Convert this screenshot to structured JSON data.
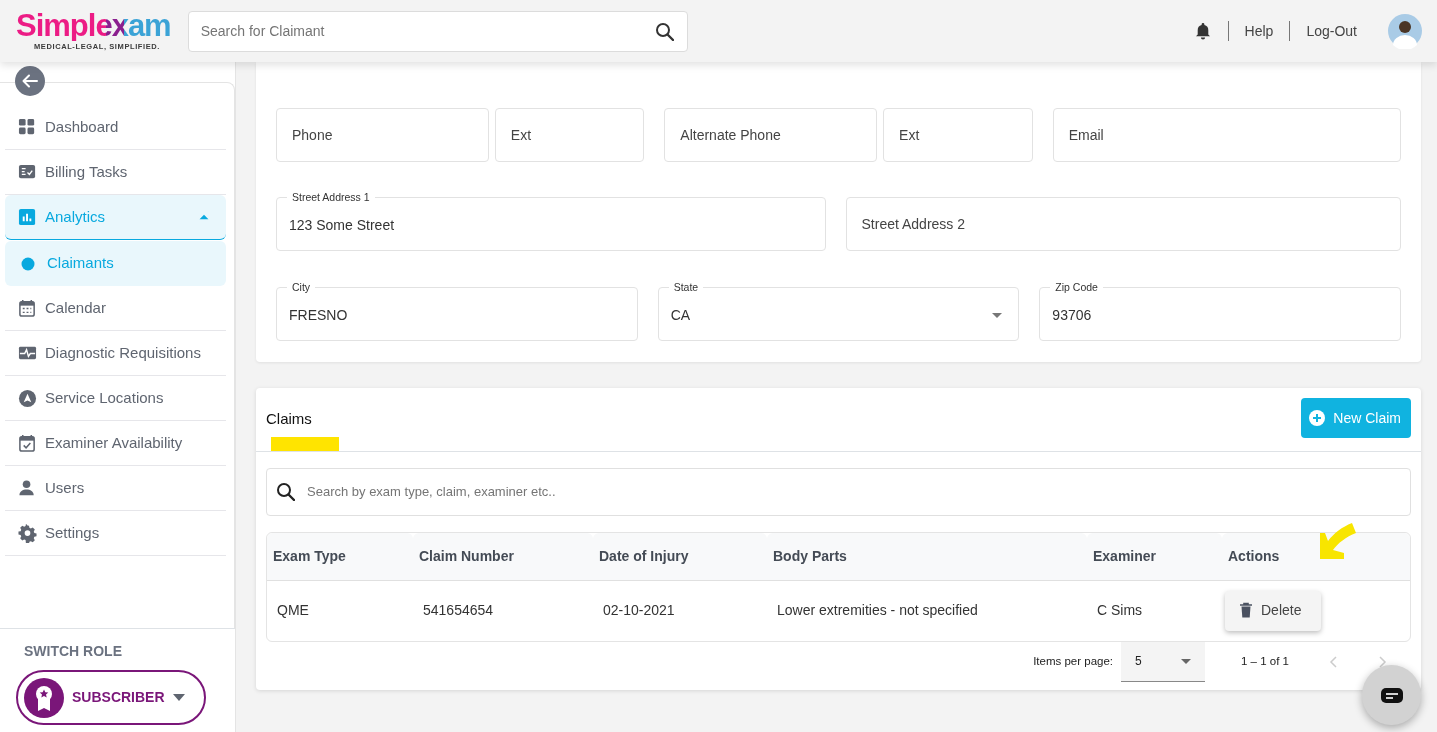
{
  "header": {
    "logo": "Simplexam",
    "tagline": "MEDICAL-LEGAL, SIMPLIFIED.",
    "search": {
      "placeholder": "Search for Claimant"
    },
    "links": [
      "Help",
      "Log-Out"
    ]
  },
  "sidebar": {
    "items": [
      {
        "label": "Dashboard",
        "selected": false
      },
      {
        "label": "Billing Tasks",
        "selected": false
      },
      {
        "label": "Analytics",
        "selected": false,
        "expanded": true,
        "children": [
          {
            "label": "Claimants",
            "selected": true
          }
        ]
      },
      {
        "label": "Calendar",
        "selected": false
      },
      {
        "label": "Diagnostic Requisitions",
        "selected": false
      },
      {
        "label": "Service Locations",
        "selected": false
      },
      {
        "label": "Examiner Availability",
        "selected": false
      },
      {
        "label": "Users",
        "selected": false
      },
      {
        "label": "Settings",
        "selected": false
      }
    ],
    "switch_role": {
      "title": "SWITCH ROLE",
      "role": "SUBSCRIBER"
    }
  },
  "form": {
    "fields": [
      {
        "label": "Phone",
        "kind": "text"
      },
      {
        "label": "Ext",
        "kind": "text"
      },
      {
        "label": "Alternate Phone",
        "kind": "text"
      },
      {
        "label": "Ext",
        "kind": "text"
      },
      {
        "label": "Email",
        "kind": "text"
      },
      {
        "label": "Street Address 1",
        "value": "123 Some Street",
        "kind": "text"
      },
      {
        "label": "Street Address 2",
        "kind": "text"
      },
      {
        "label": "City",
        "value": "FRESNO",
        "kind": "text"
      },
      {
        "label": "State",
        "value": "CA",
        "kind": "select"
      },
      {
        "label": "Zip Code",
        "value": "93706",
        "kind": "text"
      }
    ]
  },
  "claims": {
    "title": "Claims",
    "new_button": "New Claim",
    "search": {
      "placeholder": "Search by exam type, claim, examiner etc.."
    },
    "table": {
      "columns": [
        "Exam Type",
        "Claim Number",
        "Date of Injury",
        "Body Parts",
        "Examiner",
        "Actions"
      ],
      "rows": [
        {
          "cells": [
            "QME",
            "541654654",
            "02-10-2021",
            "Lower extremities - not specified",
            "C Sims"
          ],
          "action": "Delete"
        }
      ]
    },
    "pagination": {
      "label": "Items per page:",
      "per_page": "5",
      "range": "1 – 1 of 1"
    }
  }
}
